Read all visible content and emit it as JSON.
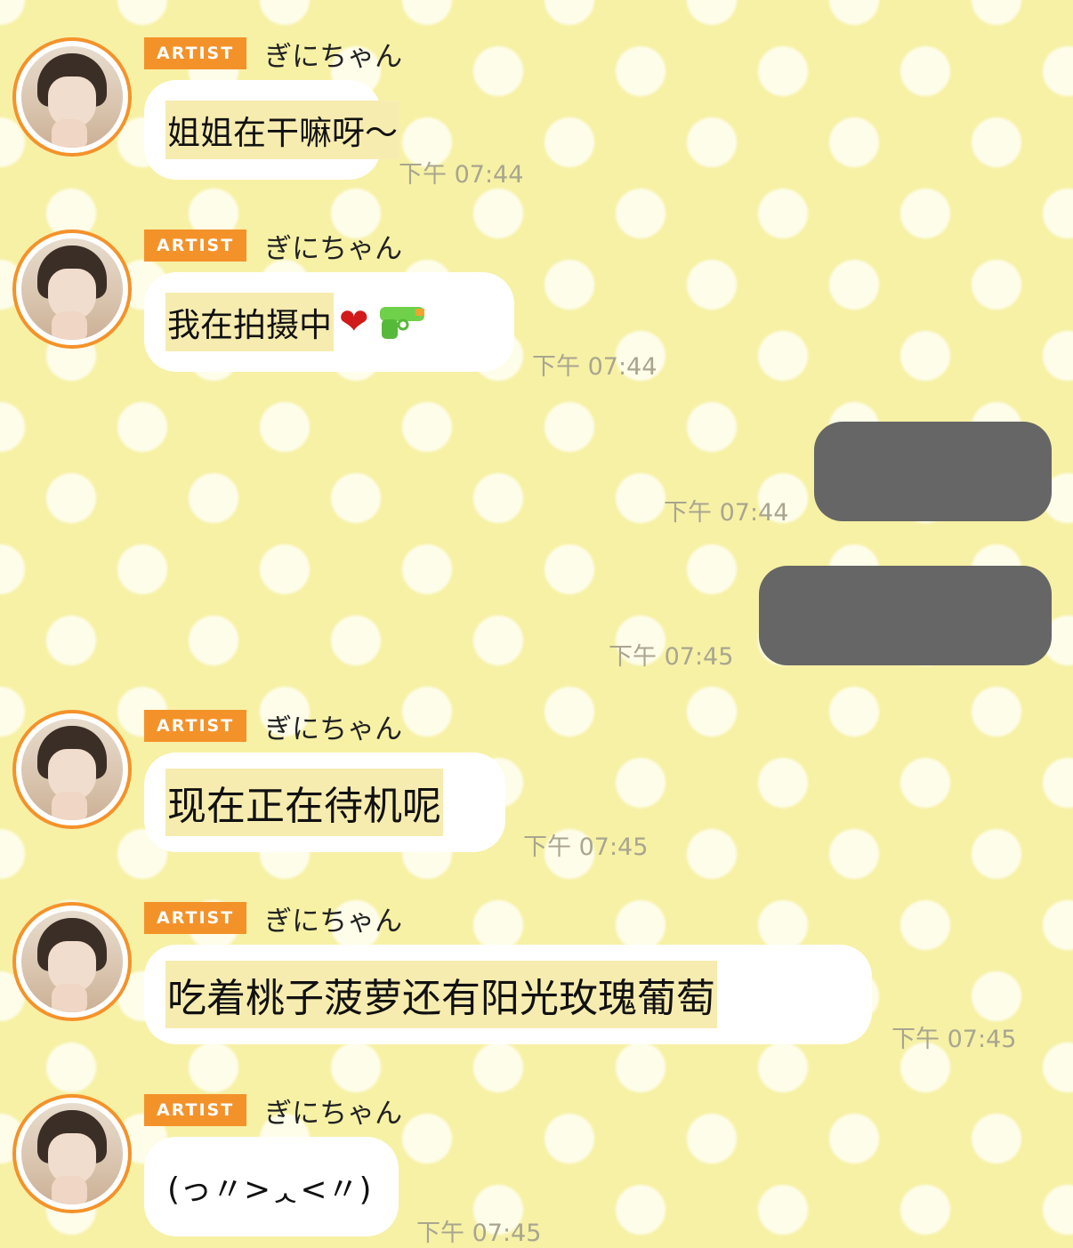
{
  "messages": [
    {
      "type": "in",
      "sender_badge": "ARTIST",
      "sender_name": "ぎにちゃん",
      "text": "姐姐在干嘛呀〜",
      "time": "下午 07:44"
    },
    {
      "type": "in",
      "sender_badge": "ARTIST",
      "sender_name": "ぎにちゃん",
      "text": "我在拍摄中",
      "emoji": [
        "heart",
        "water-pistol"
      ],
      "heart_glyph": "❤",
      "time": "下午 07:44"
    },
    {
      "type": "out",
      "time": "下午 07:44"
    },
    {
      "type": "out",
      "time": "下午 07:45"
    },
    {
      "type": "in",
      "sender_badge": "ARTIST",
      "sender_name": "ぎにちゃん",
      "text": "现在正在待机呢",
      "time": "下午 07:45"
    },
    {
      "type": "in",
      "sender_badge": "ARTIST",
      "sender_name": "ぎにちゃん",
      "text": "吃着桃子菠萝还有阳光玫瑰葡萄",
      "time": "下午 07:45"
    },
    {
      "type": "in",
      "sender_badge": "ARTIST",
      "sender_name": "ぎにちゃん",
      "text": "(っ〃>ᆺ<〃)",
      "time": "下午 07:45"
    }
  ],
  "colors": {
    "background": "#f7f1a6",
    "badge": "#f4922a",
    "bubble": "#ffffff",
    "highlight": "#f7ecb0",
    "redacted": "#666666",
    "time": "#a9a58f"
  }
}
